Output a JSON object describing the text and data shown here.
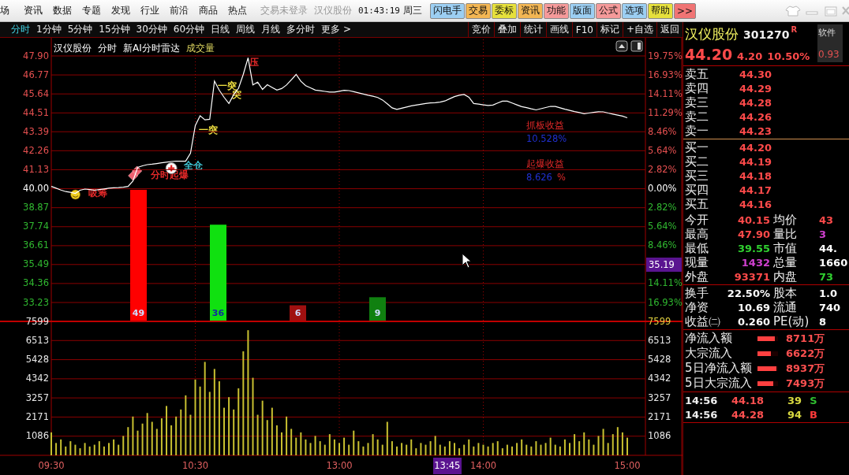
{
  "menu": {
    "items": [
      "场",
      "资讯",
      "数据",
      "专题",
      "发现",
      "行业",
      "前沿",
      "商品",
      "热点"
    ],
    "login_status": "交易未登录",
    "stock": "汉仪股份",
    "time": "01:43:19",
    "weekday": "周三",
    "quick_buttons": [
      {
        "label": "闪电手",
        "color": "#9ccff3"
      },
      {
        "label": "交易",
        "color": "#f3b653"
      },
      {
        "label": "委标",
        "color": "#e6e03c"
      },
      {
        "label": "资讯",
        "color": "#f3b653"
      },
      {
        "label": "功能",
        "color": "#f59a9a"
      },
      {
        "label": "版面",
        "color": "#9ccff3"
      },
      {
        "label": "公式",
        "color": "#f59a9a"
      },
      {
        "label": "选项",
        "color": "#9ccff3"
      },
      {
        "label": "帮助",
        "color": "#e6e03c"
      },
      {
        "label": ">>",
        "color": "#f07474"
      }
    ]
  },
  "periods": [
    {
      "label": "分时",
      "selected": true
    },
    {
      "label": "1分钟",
      "selected": false
    },
    {
      "label": "5分钟",
      "selected": false
    },
    {
      "label": "15分钟",
      "selected": false
    },
    {
      "label": "30分钟",
      "selected": false
    },
    {
      "label": "60分钟",
      "selected": false
    },
    {
      "label": "日线",
      "selected": false
    },
    {
      "label": "周线",
      "selected": false
    },
    {
      "label": "月线",
      "selected": false
    },
    {
      "label": "多分时",
      "selected": false
    },
    {
      "label": "更多 >",
      "selected": false
    }
  ],
  "tools": [
    "竞价",
    "叠加",
    "统计",
    "画线",
    "F10",
    "标记",
    "+自选",
    "返回"
  ],
  "price_chart": {
    "header": [
      {
        "text": "汉仪股份",
        "kind": "plain"
      },
      {
        "text": "分时",
        "kind": "plain"
      },
      {
        "text": "新AI分时雷达",
        "kind": "plain"
      },
      {
        "text": "成交量",
        "kind": "highlight"
      }
    ],
    "percent_axis": [
      {
        "label": "19.75%",
        "kind": "up"
      },
      {
        "label": "16.93%",
        "kind": "up"
      },
      {
        "label": "14.11%",
        "kind": "up"
      },
      {
        "label": "11.29%",
        "kind": "up"
      },
      {
        "label": "8.46%",
        "kind": "up"
      },
      {
        "label": "5.64%",
        "kind": "up"
      },
      {
        "label": "2.82%",
        "kind": "up"
      },
      {
        "label": "0.00%",
        "kind": "flat"
      },
      {
        "label": "2.82%",
        "kind": "down"
      },
      {
        "label": "5.64%",
        "kind": "down"
      },
      {
        "label": "8.46%",
        "kind": "down"
      },
      {
        "label": "35.19",
        "kind": "cursor"
      },
      {
        "label": "14.11%",
        "kind": "down"
      },
      {
        "label": "16.93%",
        "kind": "down"
      }
    ],
    "chart_data": {
      "type": "line",
      "categories": [
        null,
        null,
        null,
        null,
        null,
        null,
        null,
        null,
        null,
        null,
        null,
        null,
        null,
        null,
        null,
        null,
        null,
        null,
        null,
        null,
        null,
        null,
        null,
        null,
        null,
        null,
        null,
        null,
        null,
        null,
        null,
        null,
        null,
        null,
        null,
        null,
        null,
        null,
        null,
        null,
        null,
        null,
        null,
        null,
        null,
        null,
        null,
        null,
        null,
        null,
        null,
        null,
        null,
        null,
        null,
        null,
        null,
        null,
        null,
        null,
        null,
        null,
        null,
        null,
        null,
        null,
        null,
        null,
        null,
        null,
        null,
        null,
        null,
        null,
        null,
        null,
        null,
        null,
        null,
        null,
        null,
        null,
        null,
        null,
        null,
        null,
        null,
        null,
        null,
        null,
        null,
        null,
        null,
        null,
        null,
        null,
        null,
        null,
        null,
        null,
        null,
        null,
        null,
        null,
        null,
        null,
        null,
        null,
        null,
        null,
        null,
        null,
        null,
        null,
        null,
        null,
        null,
        null,
        null,
        null,
        null
      ],
      "series": [
        {
          "color": "#ffffff",
          "values": [
            40.14,
            40.03,
            39.92,
            39.83,
            39.78,
            39.72,
            39.91,
            39.98,
            39.95,
            39.91,
            39.95,
            39.99,
            40.03,
            40.06,
            40.07,
            40.09,
            40.14,
            40.45,
            41.27,
            41.36,
            41.43,
            41.46,
            41.5,
            41.54,
            41.58,
            41.62,
            41.64,
            41.64,
            41.64,
            42.11,
            43.75,
            44.34,
            44.1,
            44.13,
            46.4,
            45.86,
            45.44,
            45.07,
            45.6,
            45.98,
            46.8,
            47.79,
            46.18,
            46.34,
            45.91,
            46.19,
            46.03,
            45.87,
            45.96,
            46.17,
            46.48,
            46.8,
            46.39,
            46.13,
            46.0,
            45.87,
            45.83,
            45.79,
            45.75,
            45.75,
            45.8,
            45.85,
            45.84,
            45.77,
            45.7,
            45.63,
            45.56,
            45.5,
            45.43,
            45.28,
            45.05,
            44.81,
            44.72,
            44.79,
            44.86,
            44.93,
            44.98,
            45.02,
            45.07,
            45.1,
            45.12,
            45.15,
            45.22,
            45.35,
            45.48,
            45.56,
            45.61,
            45.44,
            45.07,
            45.03,
            44.99,
            44.95,
            44.98,
            45.1,
            45.21,
            45.21,
            45.1,
            44.99,
            44.88,
            44.82,
            44.75,
            44.69,
            44.76,
            44.83,
            44.9,
            44.89,
            44.81,
            44.73,
            44.66,
            44.59,
            44.53,
            44.46,
            44.5,
            44.54,
            44.58,
            44.57,
            44.5,
            44.44,
            44.38,
            44.32,
            44.22
          ]
        }
      ],
      "ylim": [
        33.23,
        47.9
      ],
      "yticks": [
        {
          "value": 47.9,
          "label": "47.90"
        },
        {
          "value": 46.77,
          "label": "46.77"
        },
        {
          "value": 45.64,
          "label": "45.64"
        },
        {
          "value": 44.51,
          "label": "44.51"
        },
        {
          "value": 43.39,
          "label": "43.39"
        },
        {
          "value": 42.26,
          "label": "42.26"
        },
        {
          "value": 41.13,
          "label": "41.13"
        },
        {
          "value": 40.0,
          "label": "40.00"
        },
        {
          "value": 38.87,
          "label": "38.87"
        },
        {
          "value": 37.74,
          "label": "37.74"
        },
        {
          "value": 36.61,
          "label": "36.61"
        },
        {
          "value": 35.49,
          "label": "35.49"
        },
        {
          "value": 34.36,
          "label": "34.36"
        },
        {
          "value": 33.23,
          "label": "33.23"
        }
      ],
      "grid": true
    },
    "signals": [
      {
        "text": "吸筹",
        "color": "#e02828"
      },
      {
        "text": "分时起爆",
        "color": "#e02828"
      },
      {
        "text": "全仓",
        "color": "#40c8d8"
      },
      {
        "text": "一突",
        "color": "#f0e040"
      },
      {
        "text": "一突",
        "color": "#f0e040"
      },
      {
        "text": "一突",
        "color": "#f0e040"
      },
      {
        "text": "压",
        "color": "#e02828"
      }
    ],
    "signal_bars": {
      "chart_data": {
        "type": "bar",
        "stacked": true,
        "categories": [
          null,
          null,
          null,
          null
        ],
        "data_labels": true,
        "series": [
          {
            "color": "#ff0000",
            "values": [
              49,
              null,
              null,
              null
            ]
          },
          {
            "color": "#10e010",
            "values": [
              null,
              36,
              null,
              null
            ]
          },
          {
            "color": "#a01010",
            "values": [
              null,
              null,
              6,
              null
            ]
          },
          {
            "color": "#108010",
            "values": [
              null,
              null,
              null,
              9
            ]
          }
        ]
      }
    },
    "profit_notes": [
      {
        "title": "抓板收益",
        "value": "10.528%"
      },
      {
        "title": "起爆收益",
        "value": "8.626",
        "unit": "%"
      }
    ]
  },
  "volume_chart": {
    "right_axis": [
      {
        "label": "7599",
        "kind": "max"
      },
      {
        "label": "6513",
        "kind": "tick"
      },
      {
        "label": "5428",
        "kind": "tick"
      },
      {
        "label": "4342",
        "kind": "tick"
      },
      {
        "label": "3257",
        "kind": "tick"
      },
      {
        "label": "2171",
        "kind": "tick"
      },
      {
        "label": "1086",
        "kind": "tick"
      }
    ],
    "cursor_time": "13:45",
    "chart_data": {
      "type": "bar",
      "categories": [
        "09:30",
        null,
        null,
        null,
        null,
        null,
        null,
        null,
        null,
        null,
        null,
        null,
        null,
        null,
        null,
        null,
        null,
        null,
        null,
        null,
        null,
        null,
        null,
        null,
        null,
        null,
        null,
        null,
        null,
        null,
        "10:30",
        null,
        null,
        null,
        null,
        null,
        null,
        null,
        null,
        null,
        null,
        null,
        null,
        null,
        null,
        null,
        null,
        null,
        null,
        null,
        null,
        null,
        null,
        null,
        null,
        null,
        null,
        null,
        null,
        null,
        "13:00",
        null,
        null,
        null,
        null,
        null,
        null,
        null,
        null,
        null,
        null,
        null,
        null,
        null,
        null,
        null,
        null,
        null,
        null,
        null,
        null,
        null,
        null,
        null,
        null,
        null,
        null,
        null,
        null,
        null,
        "14:00",
        null,
        null,
        null,
        null,
        null,
        null,
        null,
        null,
        null,
        null,
        null,
        null,
        null,
        null,
        null,
        null,
        null,
        null,
        null,
        null,
        null,
        null,
        null,
        null,
        null,
        null,
        null,
        null,
        null,
        "15:00"
      ],
      "series": [
        {
          "color": "#c8c030",
          "values": [
            1300,
            700,
            900,
            500,
            800,
            600,
            400,
            700,
            500,
            600,
            800,
            500,
            700,
            900,
            600,
            1100,
            1600,
            2200,
            1400,
            1800,
            2400,
            1900,
            1500,
            2100,
            2800,
            1700,
            2200,
            2600,
            3400,
            2300,
            4300,
            3900,
            5300,
            3600,
            4900,
            4200,
            2700,
            3300,
            2600,
            3800,
            5900,
            7100,
            4400,
            2300,
            3100,
            2000,
            2700,
            1700,
            1300,
            2200,
            1500,
            1000,
            1300,
            900,
            700,
            1100,
            800,
            600,
            1200,
            900,
            700,
            1000,
            600,
            1400,
            800,
            500,
            700,
            1200,
            900,
            600,
            1900,
            800,
            500,
            700,
            600,
            900,
            400,
            700,
            600,
            800,
            1100,
            600,
            500,
            800,
            700,
            400,
            600,
            900,
            500,
            700,
            600,
            500,
            700,
            800,
            400,
            600,
            500,
            700,
            900,
            600,
            500,
            800,
            600,
            700,
            1000,
            600,
            500,
            900,
            700,
            1200,
            800,
            1300,
            900,
            600,
            1100,
            1500,
            700,
            1200,
            1600,
            1300,
            1000
          ]
        }
      ],
      "ylim": [
        0,
        7599
      ],
      "grid": true,
      "yticks": [
        {
          "value": 7599,
          "label": "7599"
        },
        {
          "value": 6513,
          "label": "6513"
        },
        {
          "value": 5428,
          "label": "5428"
        },
        {
          "value": 4342,
          "label": "4342"
        },
        {
          "value": 3257,
          "label": "3257"
        },
        {
          "value": 2171,
          "label": "2171"
        },
        {
          "value": 1086,
          "label": "1086"
        }
      ]
    }
  },
  "quote": {
    "name": "汉仪股份",
    "code": "301270",
    "badge": "R",
    "side_tab": "软件",
    "price": "44.20",
    "change": "4.20",
    "change_pct": "10.50%",
    "side_value": "0.93"
  },
  "asks": [
    {
      "label": "卖五",
      "price": "44.30"
    },
    {
      "label": "卖四",
      "price": "44.29"
    },
    {
      "label": "卖三",
      "price": "44.28"
    },
    {
      "label": "卖二",
      "price": "44.26"
    },
    {
      "label": "卖一",
      "price": "44.23"
    }
  ],
  "bids": [
    {
      "label": "买一",
      "price": "44.20"
    },
    {
      "label": "买二",
      "price": "44.19"
    },
    {
      "label": "买三",
      "price": "44.18"
    },
    {
      "label": "买四",
      "price": "44.17"
    },
    {
      "label": "买五",
      "price": "44.16"
    }
  ],
  "stats": [
    [
      {
        "label": "今开",
        "value": "40.15",
        "color": "#ff4a4a"
      },
      {
        "label": "均价",
        "value": "43",
        "color": "#ff4a4a"
      }
    ],
    [
      {
        "label": "最高",
        "value": "47.90",
        "color": "#ff4a4a"
      },
      {
        "label": "量比",
        "value": "3",
        "color": "#d040d0"
      }
    ],
    [
      {
        "label": "最低",
        "value": "39.55",
        "color": "#30d030"
      },
      {
        "label": "市值",
        "value": "44.",
        "color": "#ffffff"
      }
    ],
    [
      {
        "label": "现量",
        "value": "1432",
        "color": "#d040d0"
      },
      {
        "label": "总量",
        "value": "1660",
        "color": "#ffffff"
      }
    ],
    [
      {
        "label": "外盘",
        "value": "93371",
        "color": "#ff4a4a"
      },
      {
        "label": "内盘",
        "value": "73",
        "color": "#30d030"
      }
    ]
  ],
  "finance": [
    [
      {
        "label": "换手",
        "value": "22.50%"
      },
      {
        "label": "股本",
        "value": "1.0"
      }
    ],
    [
      {
        "label": "净资",
        "value": "10.69"
      },
      {
        "label": "流通",
        "value": "740"
      }
    ],
    [
      {
        "label": "收益㈡",
        "value": "0.260"
      },
      {
        "label": "PE(动)",
        "value": "8"
      }
    ]
  ],
  "flows": [
    {
      "label": "净流入额",
      "level": 0.85,
      "value": "8711万"
    },
    {
      "label": "大宗流入",
      "level": 0.65,
      "value": "6622万"
    },
    {
      "label": "5日净流入额",
      "level": 0.92,
      "value": "8937万"
    },
    {
      "label": "5日大宗流入",
      "level": 0.75,
      "value": "7493万"
    }
  ],
  "trades": [
    {
      "time": "14:56",
      "price": "44.18",
      "volume": "39",
      "side": "S",
      "kind": "sell"
    },
    {
      "time": "14:56",
      "price": "44.28",
      "volume": "94",
      "side": "B",
      "kind": "buy"
    }
  ]
}
